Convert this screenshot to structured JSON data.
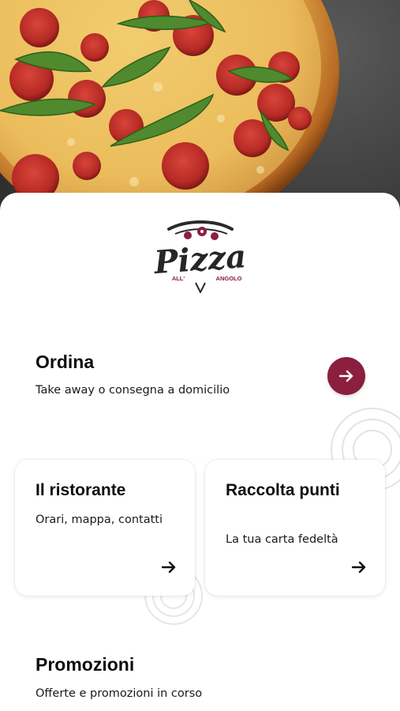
{
  "hero": {
    "image": "pepperoni-pizza-photo"
  },
  "logo": {
    "word": "Pizza",
    "left_word": "ALL'",
    "right_word": "ANGOLO"
  },
  "order": {
    "title": "Ordina",
    "subtitle": "Take away o consegna a domicilio",
    "icon": "arrow-right-icon",
    "accent": "#8a1f3e"
  },
  "cards": [
    {
      "title": "Il ristorante",
      "subtitle": "Orari, mappa, contatti",
      "icon": "arrow-right-icon"
    },
    {
      "title": "Raccolta punti",
      "subtitle": "La tua carta fedeltà",
      "icon": "arrow-right-icon"
    }
  ],
  "promo": {
    "title": "Promozioni",
    "subtitle": "Offerte e promozioni in corso"
  }
}
